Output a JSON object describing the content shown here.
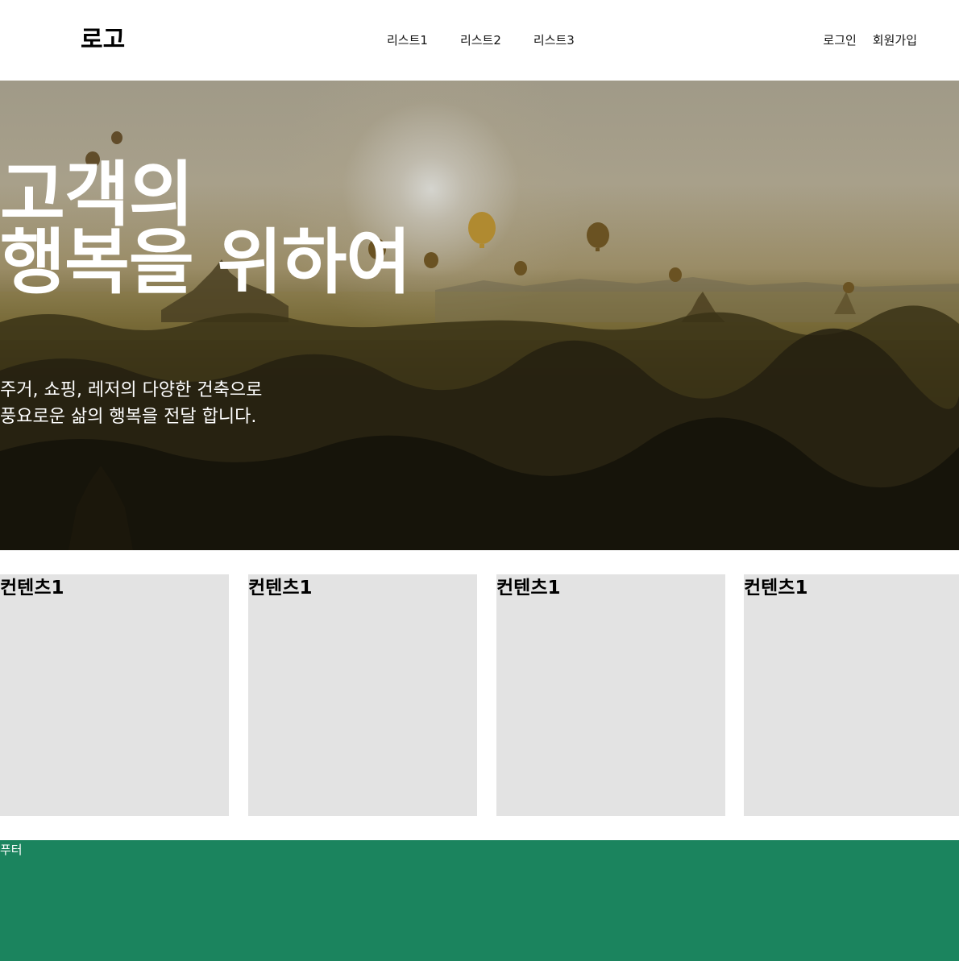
{
  "header": {
    "logo": "로고",
    "nav": [
      "리스트1",
      "리스트2",
      "리스트3"
    ],
    "login": "로그인",
    "signup": "회원가입"
  },
  "hero": {
    "title": "고객의\n행복을 위하여",
    "subtitle": "주거, 쇼핑, 레저의 다양한 건축으로\n풍요로운 삶의 행복을 전달 합니다."
  },
  "cards": [
    {
      "title": "컨텐츠1"
    },
    {
      "title": "컨텐츠1"
    },
    {
      "title": "컨텐츠1"
    },
    {
      "title": "컨텐츠1"
    }
  ],
  "footer": {
    "text": "푸터"
  },
  "colors": {
    "card_bg": "#e3e3e3",
    "footer_bg": "#1b845e",
    "text_light": "#ffffff"
  }
}
